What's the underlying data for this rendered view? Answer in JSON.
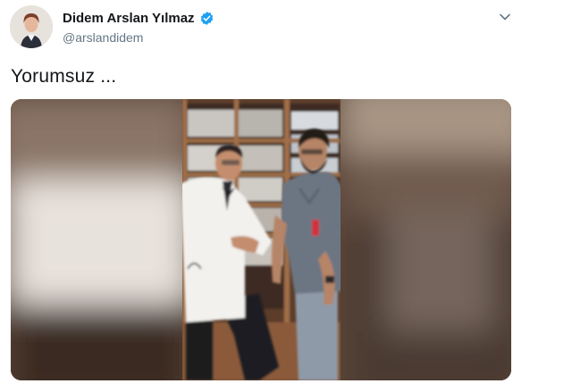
{
  "author": {
    "name": "Didem Arslan Yılmaz",
    "handle": "@arslandidem",
    "verified": true
  },
  "tweet": {
    "text": "Yorumsuz ..."
  },
  "icons": {
    "avatar": "profile-photo",
    "verified": "verified-badge-icon",
    "menu": "chevron-down-icon"
  },
  "colors": {
    "verified": "#1da1f2",
    "name": "#14171a",
    "handle": "#657786"
  }
}
